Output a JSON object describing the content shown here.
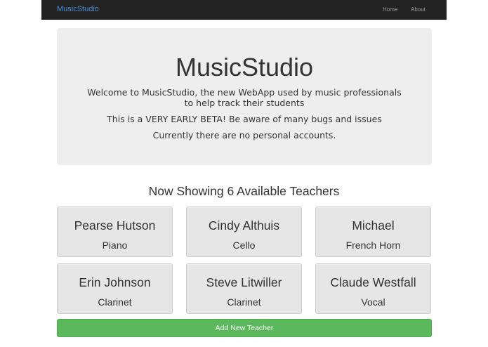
{
  "navbar": {
    "brand": "MusicStudio",
    "links": [
      {
        "label": "Home"
      },
      {
        "label": "About"
      }
    ]
  },
  "jumbotron": {
    "title": "MusicStudio",
    "line1": "Welcome to MusicStudio, the new WebApp used by music professionals to help track their students",
    "line2": "This is a VERY EARLY BETA! Be aware of many bugs and issues",
    "line3": "Currently there are no personal accounts."
  },
  "teachers_heading": "Now Showing 6 Available Teachers",
  "teachers": [
    {
      "name": "Pearse Hutson",
      "instrument": "Piano"
    },
    {
      "name": "Cindy Althuis",
      "instrument": "Cello"
    },
    {
      "name": "Michael",
      "instrument": "French Horn"
    },
    {
      "name": "Erin Johnson",
      "instrument": "Clarinet"
    },
    {
      "name": "Steve Litwiller",
      "instrument": "Clarinet"
    },
    {
      "name": "Claude Westfall",
      "instrument": "Vocal"
    }
  ],
  "add_button_label": "Add New Teacher",
  "colors": {
    "navbar_bg": "#222222",
    "brand": "#4a8fd6",
    "jumbotron_bg": "#eeeeee",
    "card_bg": "#e6e6e6",
    "success": "#5cb85c"
  }
}
